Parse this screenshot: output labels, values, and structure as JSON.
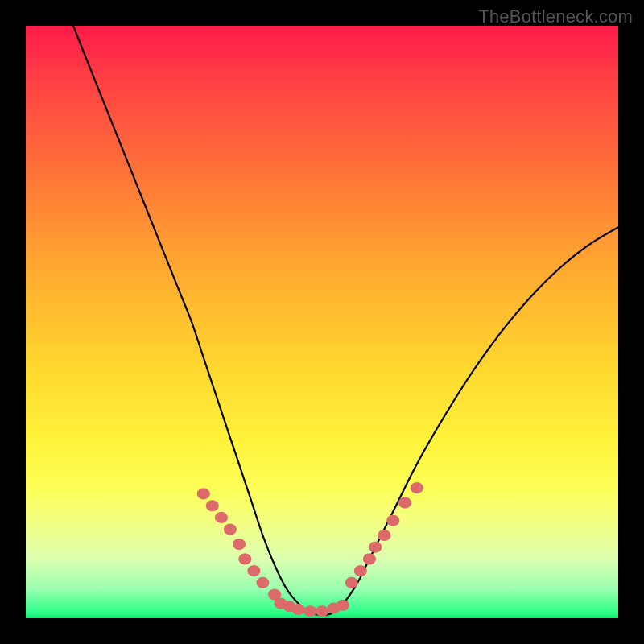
{
  "watermark": {
    "text": "TheBottleneck.com"
  },
  "chart_data": {
    "type": "line",
    "title": "",
    "xlabel": "",
    "ylabel": "",
    "xlim": [
      0,
      100
    ],
    "ylim": [
      0,
      100
    ],
    "grid": false,
    "legend": false,
    "series": [
      {
        "name": "bottleneck-curve",
        "x": [
          8,
          12,
          16,
          20,
          24,
          26,
          28,
          30,
          32,
          34,
          36,
          38,
          40,
          42,
          44,
          46,
          48,
          50,
          52,
          54,
          56,
          58,
          62,
          66,
          70,
          75,
          80,
          85,
          90,
          95,
          100
        ],
        "y": [
          100,
          90,
          80,
          70,
          60,
          55,
          50,
          44,
          38,
          32,
          26,
          20,
          14,
          9,
          5,
          2.5,
          1,
          0.5,
          1,
          3,
          6,
          10,
          18,
          26,
          33,
          41,
          48,
          54,
          59,
          63,
          66
        ]
      }
    ],
    "markers": [
      {
        "name": "left-cluster",
        "x": [
          30,
          31.5,
          33,
          34.5,
          36,
          37,
          38.5,
          40,
          42
        ],
        "y": [
          21,
          19,
          17,
          15,
          12.5,
          10,
          8,
          6,
          4
        ]
      },
      {
        "name": "bottom-cluster",
        "x": [
          43,
          44.5,
          46,
          48,
          50,
          52,
          53.5
        ],
        "y": [
          2.5,
          2,
          1.5,
          1.2,
          1.2,
          1.7,
          2.2
        ]
      },
      {
        "name": "right-cluster",
        "x": [
          55,
          56.5,
          58,
          59,
          60.5,
          62,
          64,
          66
        ],
        "y": [
          6,
          8,
          10,
          12,
          14,
          16.5,
          19.5,
          22
        ]
      }
    ],
    "colors": {
      "curve": "#000000",
      "marker_fill": "#dd6a6a",
      "gradient_top": "#ff1b4a",
      "gradient_bottom": "#16e86f"
    }
  }
}
